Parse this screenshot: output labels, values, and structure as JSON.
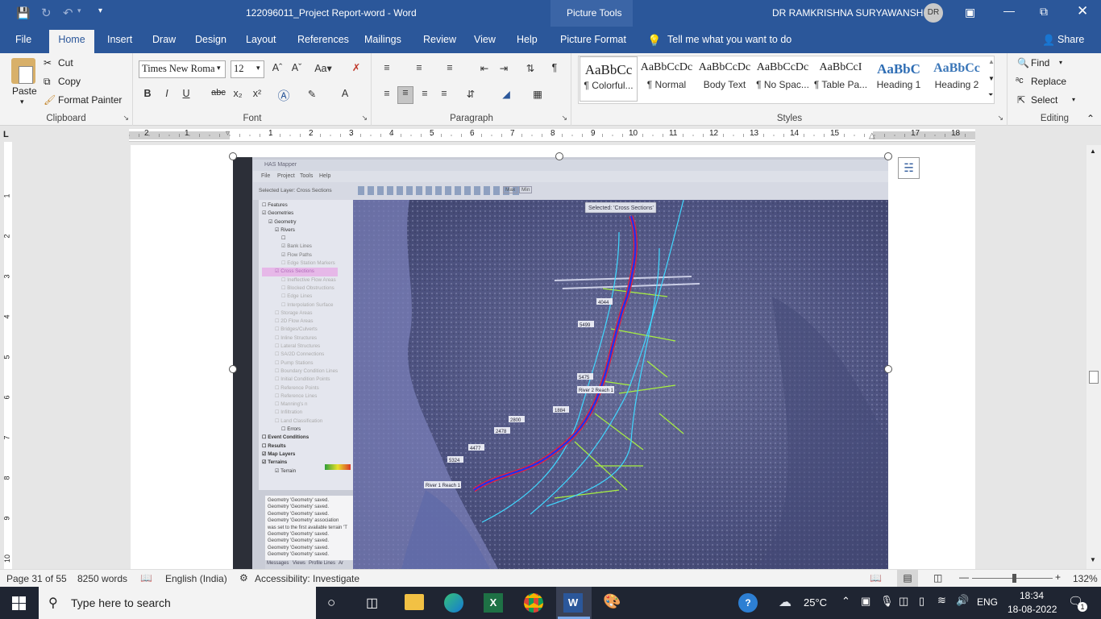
{
  "window": {
    "title": "122096011_Project Report-word  -  Word",
    "context_tools": "Picture Tools",
    "user": "DR RAMKRISHNA SURYAWANSHI",
    "user_initials": "DR"
  },
  "tabs": [
    "File",
    "Home",
    "Insert",
    "Draw",
    "Design",
    "Layout",
    "References",
    "Mailings",
    "Review",
    "View",
    "Help",
    "Picture Format"
  ],
  "tell_me": "Tell me what you want to do",
  "share": "Share",
  "clipboard": {
    "paste": "Paste",
    "cut": "Cut",
    "copy": "Copy",
    "format_painter": "Format Painter",
    "label": "Clipboard"
  },
  "font": {
    "name": "Times New Roma",
    "size": "12",
    "label": "Font"
  },
  "paragraph": {
    "label": "Paragraph"
  },
  "styles": {
    "label": "Styles",
    "items": [
      {
        "preview": "AaBbCc",
        "name": "¶ Colorful..."
      },
      {
        "preview": "AaBbCcDc",
        "name": "¶ Normal"
      },
      {
        "preview": "AaBbCcDc",
        "name": "Body Text"
      },
      {
        "preview": "AaBbCcDc",
        "name": "¶ No Spac..."
      },
      {
        "preview": "AaBbCcI",
        "name": "¶ Table Pa..."
      },
      {
        "preview": "AaBbC",
        "name": "Heading 1"
      },
      {
        "preview": "AaBbCc",
        "name": "Heading 2"
      }
    ]
  },
  "editing": {
    "find": "Find",
    "replace": "Replace",
    "select": "Select",
    "label": "Editing"
  },
  "ruler": {
    "numbers": [
      "2",
      "1",
      "1",
      "2",
      "3",
      "4",
      "5",
      "6",
      "7",
      "8",
      "9",
      "10",
      "11",
      "12",
      "13",
      "14",
      "15",
      "16",
      "17",
      "18"
    ],
    "vnumbers": [
      "1",
      "2",
      "3",
      "4",
      "5",
      "6",
      "7",
      "8",
      "9",
      "10"
    ]
  },
  "hec": {
    "title": "HAS Mapper",
    "menus": [
      "File",
      "Project",
      "Tools",
      "Help"
    ],
    "selected_layer": "Selected Layer: Cross Sections",
    "banner": "Selected: 'Cross Sections'",
    "tree": [
      "Features",
      "Geometries",
      "Geometry",
      "Rivers",
      "",
      "Bank Lines",
      "Flow Paths",
      "Edge Station Markers",
      "Cross Sections",
      "Ineffective Flow Areas",
      "Blocked Obstructions",
      "Edge Lines",
      "Interpolation Surface",
      "Storage Areas",
      "2D Flow Areas",
      "Bridges/Culverts",
      "Inline Structures",
      "Lateral Structures",
      "SA/2D Connections",
      "Pump Stations",
      "Boundary Condition Lines",
      "Initial Condition Points",
      "Reference Points",
      "Reference Lines",
      "Manning's n",
      "Infiltration",
      "Land Classification",
      "Errors",
      "Event Conditions",
      "Results",
      "Map Layers",
      "Terrains",
      "Terrain"
    ],
    "messages": [
      "Geometry 'Geometry' saved.",
      "Geometry 'Geometry' saved.",
      "Geometry 'Geometry' saved.",
      "Geometry 'Geometry' association",
      "was set to the first available terrain 'T",
      "Geometry 'Geometry' saved.",
      "Geometry 'Geometry' saved.",
      "Geometry 'Geometry' saved.",
      "Geometry 'Geometry' saved."
    ],
    "bottom_tabs": [
      "Messages",
      "Views",
      "Profile Lines",
      "Ar"
    ],
    "xs_labels": [
      "4044",
      "5499",
      "5475",
      "1884",
      "2800",
      "2478",
      "4477",
      "5324"
    ],
    "reach_labels": [
      "River 2 Reach 1",
      "River 1 Reach 1"
    ],
    "mini_buttons": [
      "Max",
      "Min"
    ]
  },
  "status": {
    "page": "Page 31 of 55",
    "words": "8250 words",
    "language": "English (India)",
    "accessibility": "Accessibility: Investigate",
    "zoom": "132%"
  },
  "taskbar": {
    "search_placeholder": "Type here to search",
    "temperature": "25°C",
    "lang": "ENG",
    "time": "18:34",
    "date": "18-08-2022",
    "notifications": "1"
  }
}
